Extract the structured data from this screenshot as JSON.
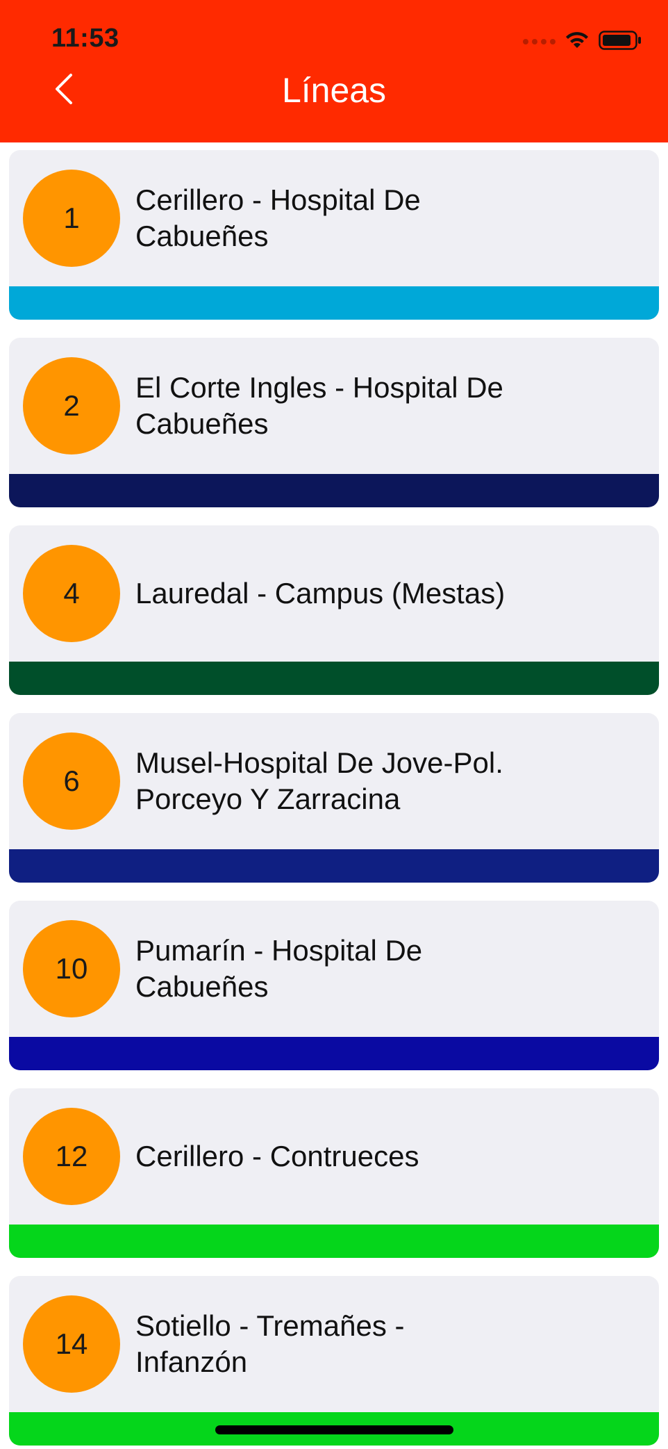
{
  "status_bar": {
    "time": "11:53"
  },
  "header": {
    "title": "Líneas",
    "back_icon": "chevron-left-icon",
    "background_color": "#ff2a00"
  },
  "lines": [
    {
      "number": "1",
      "name": "Cerillero - Hospital De Cabueñes",
      "color": "#00a8d8"
    },
    {
      "number": "2",
      "name": "El Corte Ingles - Hospital De Cabueñes",
      "color": "#0c165a"
    },
    {
      "number": "4",
      "name": "Lauredal - Campus (Mestas)",
      "color": "#004f2a"
    },
    {
      "number": "6",
      "name": "Musel-Hospital De Jove-Pol. Porceyo Y Zarracina",
      "color": "#0f1f82"
    },
    {
      "number": "10",
      "name": "Pumarín - Hospital De Cabueñes",
      "color": "#0a0aa2"
    },
    {
      "number": "12",
      "name": "Cerillero - Contrueces",
      "color": "#05d61b"
    },
    {
      "number": "14",
      "name": "Sotiello - Tremañes - Infanzón",
      "color": "#05d61b"
    }
  ],
  "badge_color": "#ff9500"
}
